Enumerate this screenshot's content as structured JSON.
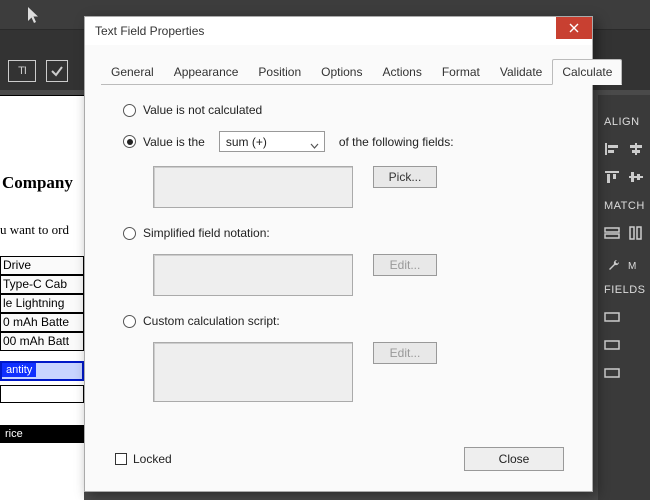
{
  "dialog": {
    "title": "Text Field Properties",
    "tabs": [
      "General",
      "Appearance",
      "Position",
      "Options",
      "Actions",
      "Format",
      "Validate",
      "Calculate"
    ],
    "active_tab": "Calculate",
    "radio_not_calculated": "Value is not calculated",
    "radio_value_is_the": "Value is the",
    "agg_select": "sum (+)",
    "of_following": "of the following fields:",
    "pick_btn": "Pick...",
    "radio_simplified": "Simplified field notation:",
    "edit_btn": "Edit...",
    "radio_custom": "Custom calculation script:",
    "locked_label": "Locked",
    "close_btn": "Close"
  },
  "background": {
    "company_label": "Company",
    "order_line": "u want to ord",
    "cells": [
      "Drive",
      "Type-C Cab",
      "le Lightning",
      "0 mAh Batte",
      "00 mAh Batt"
    ],
    "selected_field": "antity",
    "dark_field": "rice",
    "tool_ti": "TI"
  },
  "right_panel": {
    "align": "ALIGN",
    "match": "MATCH",
    "tools_letter": "M",
    "fields": "FIELDS"
  }
}
